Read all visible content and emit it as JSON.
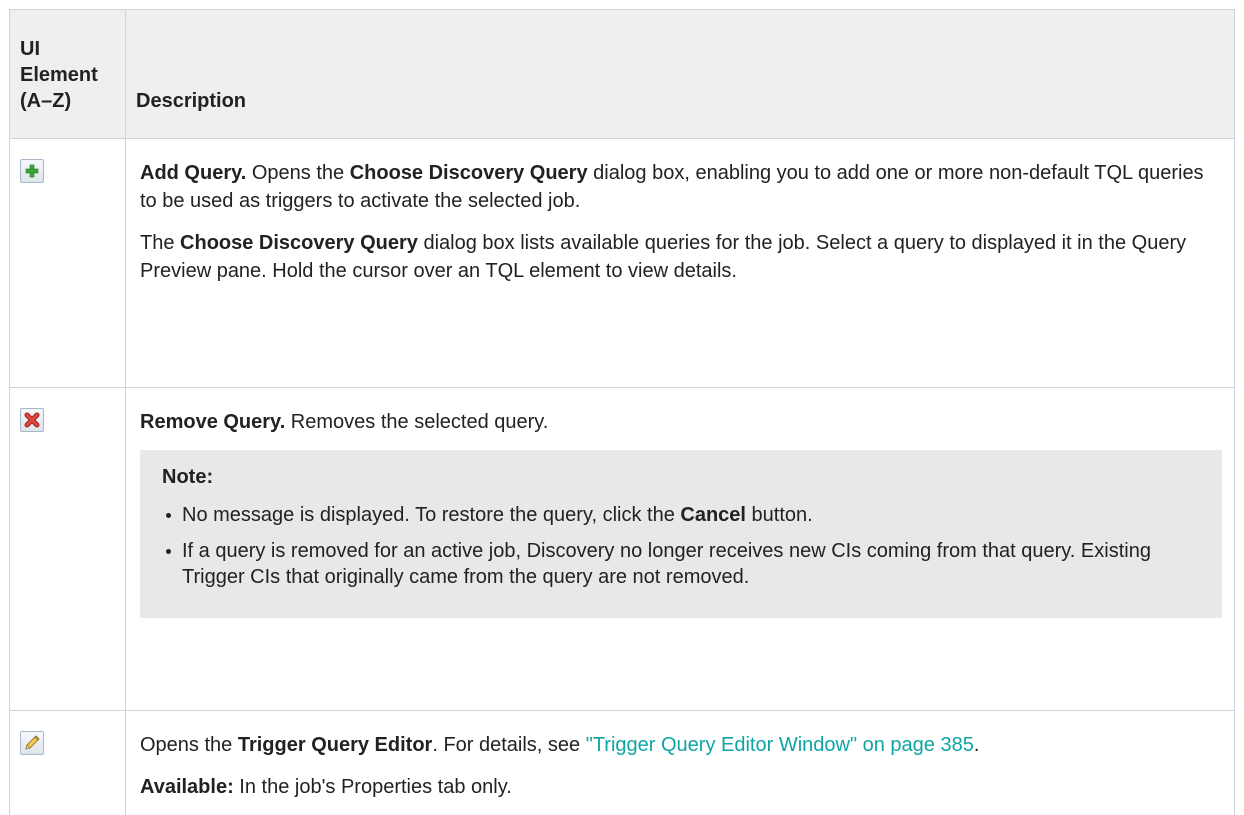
{
  "table": {
    "header": {
      "col1_line1": "UI",
      "col1_line2": "Element",
      "col1_line3": "(A–Z)",
      "col2": "Description"
    },
    "rows": [
      {
        "icon": "add-query-icon",
        "p1": {
          "bold1": "Add Query.",
          "text1": " Opens the ",
          "bold2": "Choose Discovery Query",
          "text2": " dialog box, enabling you to add one or more non-default TQL queries to be used as triggers to activate the selected job."
        },
        "p2": {
          "text0": "The ",
          "bold1": "Choose Discovery Query",
          "text1": " dialog box lists available queries for the job. Select a query to displayed it in the Query Preview pane. Hold the cursor over an TQL element to view details."
        }
      },
      {
        "icon": "remove-query-icon",
        "p1": {
          "bold1": "Remove Query.",
          "text1": " Removes the selected query."
        },
        "note": {
          "title": "Note:",
          "item1": {
            "text1": "No message is displayed. To restore the query, click the ",
            "bold1": "Cancel",
            "text2": " button."
          },
          "item2": "If a query is removed for an active job, Discovery no longer receives new CIs coming from that query. Existing Trigger CIs that originally came from the query are not removed."
        }
      },
      {
        "icon": "edit-query-icon",
        "p1": {
          "text1": "Opens the ",
          "bold1": "Trigger Query Editor",
          "text2": ". For details, see ",
          "link": "\"Trigger Query Editor Window\" on page 385",
          "text3": "."
        },
        "p2": {
          "bold1": "Available:",
          "text1": " In the job's Properties tab only."
        }
      }
    ]
  },
  "colors": {
    "link": "#0ea5a5",
    "header_bg": "#efefef",
    "note_bg": "#e6e8ea",
    "add_icon": "#3aa63a",
    "remove_icon": "#d9342b"
  }
}
